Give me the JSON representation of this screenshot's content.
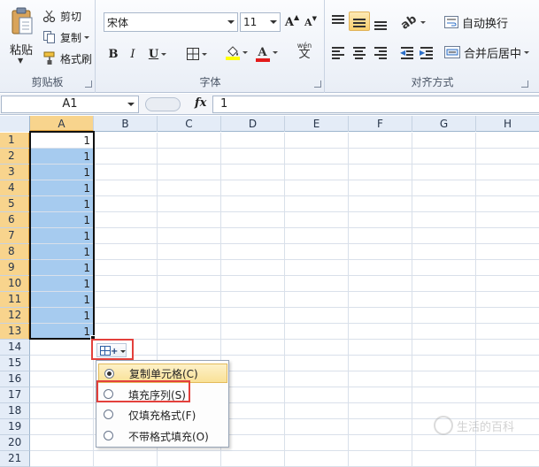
{
  "clipboard": {
    "paste_label": "粘贴",
    "cut_label": "剪切",
    "copy_label": "复制",
    "format_painter_label": "格式刷",
    "group_label": "剪贴板"
  },
  "font": {
    "font_name": "宋体",
    "font_size": "11",
    "grow_label": "A",
    "shrink_label": "A",
    "bold_label": "B",
    "italic_label": "I",
    "underline_label": "U",
    "wen_label": "wén",
    "wen_char": "文",
    "font_color_label": "A",
    "group_label": "字体"
  },
  "alignment": {
    "wrap_label": "自动换行",
    "merge_label": "合并后居中",
    "group_label": "对齐方式"
  },
  "formula_bar": {
    "name_box": "A1",
    "fx_label": "fx",
    "value": "1"
  },
  "grid": {
    "columns": [
      "A",
      "B",
      "C",
      "D",
      "E",
      "F",
      "G",
      "H"
    ],
    "rows": [
      "1",
      "2",
      "3",
      "4",
      "5",
      "6",
      "7",
      "8",
      "9",
      "10",
      "11",
      "12",
      "13",
      "14",
      "15",
      "16",
      "17",
      "18",
      "19",
      "20",
      "21"
    ],
    "column_a_values": [
      "1",
      "1",
      "1",
      "1",
      "1",
      "1",
      "1",
      "1",
      "1",
      "1",
      "1",
      "1",
      "1"
    ]
  },
  "autofill_menu": {
    "items": [
      {
        "label": "复制单元格(C)",
        "selected": true
      },
      {
        "label": "填充序列(S)",
        "selected": false
      },
      {
        "label": "仅填充格式(F)",
        "selected": false
      },
      {
        "label": "不带格式填充(O)",
        "selected": false
      }
    ],
    "plus_label": "+"
  },
  "watermark": {
    "text": "生活的百科"
  },
  "colors": {
    "selection_fill": "#a6cbef",
    "header_selected": "#f8d48d",
    "highlight_red": "#e3403c",
    "font_color_bar": "#e31b1b",
    "fill_color_bar": "#ffff00"
  }
}
